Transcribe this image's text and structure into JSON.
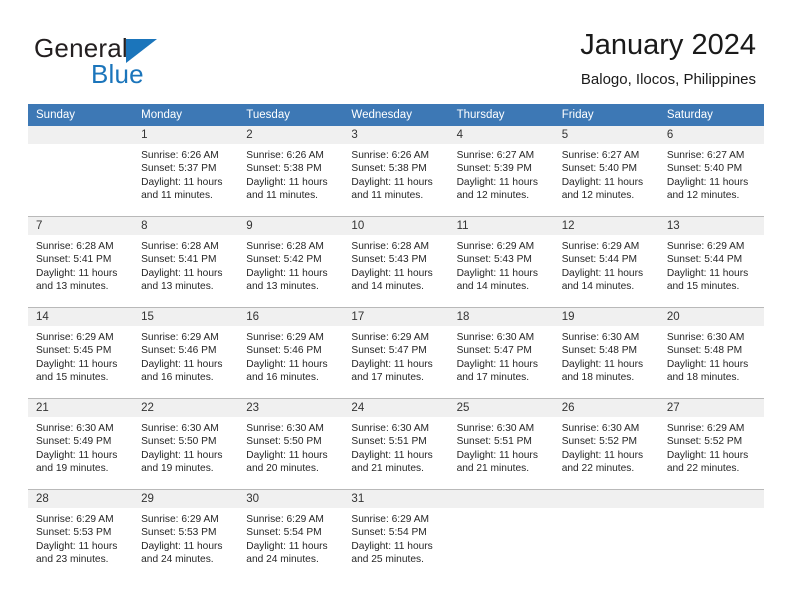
{
  "brand": {
    "name_part1": "General",
    "name_part2": "Blue",
    "accent_color": "#1b75bb"
  },
  "header": {
    "title": "January 2024",
    "subtitle": "Balogo, Ilocos, Philippines"
  },
  "calendar": {
    "header_color": "#3d78b5",
    "daynum_bg": "#f0f0f0",
    "weekdays": [
      "Sunday",
      "Monday",
      "Tuesday",
      "Wednesday",
      "Thursday",
      "Friday",
      "Saturday"
    ],
    "weeks": [
      [
        {
          "day": "",
          "lines": []
        },
        {
          "day": "1",
          "lines": [
            "Sunrise: 6:26 AM",
            "Sunset: 5:37 PM",
            "Daylight: 11 hours",
            "and 11 minutes."
          ]
        },
        {
          "day": "2",
          "lines": [
            "Sunrise: 6:26 AM",
            "Sunset: 5:38 PM",
            "Daylight: 11 hours",
            "and 11 minutes."
          ]
        },
        {
          "day": "3",
          "lines": [
            "Sunrise: 6:26 AM",
            "Sunset: 5:38 PM",
            "Daylight: 11 hours",
            "and 11 minutes."
          ]
        },
        {
          "day": "4",
          "lines": [
            "Sunrise: 6:27 AM",
            "Sunset: 5:39 PM",
            "Daylight: 11 hours",
            "and 12 minutes."
          ]
        },
        {
          "day": "5",
          "lines": [
            "Sunrise: 6:27 AM",
            "Sunset: 5:40 PM",
            "Daylight: 11 hours",
            "and 12 minutes."
          ]
        },
        {
          "day": "6",
          "lines": [
            "Sunrise: 6:27 AM",
            "Sunset: 5:40 PM",
            "Daylight: 11 hours",
            "and 12 minutes."
          ]
        }
      ],
      [
        {
          "day": "7",
          "lines": [
            "Sunrise: 6:28 AM",
            "Sunset: 5:41 PM",
            "Daylight: 11 hours",
            "and 13 minutes."
          ]
        },
        {
          "day": "8",
          "lines": [
            "Sunrise: 6:28 AM",
            "Sunset: 5:41 PM",
            "Daylight: 11 hours",
            "and 13 minutes."
          ]
        },
        {
          "day": "9",
          "lines": [
            "Sunrise: 6:28 AM",
            "Sunset: 5:42 PM",
            "Daylight: 11 hours",
            "and 13 minutes."
          ]
        },
        {
          "day": "10",
          "lines": [
            "Sunrise: 6:28 AM",
            "Sunset: 5:43 PM",
            "Daylight: 11 hours",
            "and 14 minutes."
          ]
        },
        {
          "day": "11",
          "lines": [
            "Sunrise: 6:29 AM",
            "Sunset: 5:43 PM",
            "Daylight: 11 hours",
            "and 14 minutes."
          ]
        },
        {
          "day": "12",
          "lines": [
            "Sunrise: 6:29 AM",
            "Sunset: 5:44 PM",
            "Daylight: 11 hours",
            "and 14 minutes."
          ]
        },
        {
          "day": "13",
          "lines": [
            "Sunrise: 6:29 AM",
            "Sunset: 5:44 PM",
            "Daylight: 11 hours",
            "and 15 minutes."
          ]
        }
      ],
      [
        {
          "day": "14",
          "lines": [
            "Sunrise: 6:29 AM",
            "Sunset: 5:45 PM",
            "Daylight: 11 hours",
            "and 15 minutes."
          ]
        },
        {
          "day": "15",
          "lines": [
            "Sunrise: 6:29 AM",
            "Sunset: 5:46 PM",
            "Daylight: 11 hours",
            "and 16 minutes."
          ]
        },
        {
          "day": "16",
          "lines": [
            "Sunrise: 6:29 AM",
            "Sunset: 5:46 PM",
            "Daylight: 11 hours",
            "and 16 minutes."
          ]
        },
        {
          "day": "17",
          "lines": [
            "Sunrise: 6:29 AM",
            "Sunset: 5:47 PM",
            "Daylight: 11 hours",
            "and 17 minutes."
          ]
        },
        {
          "day": "18",
          "lines": [
            "Sunrise: 6:30 AM",
            "Sunset: 5:47 PM",
            "Daylight: 11 hours",
            "and 17 minutes."
          ]
        },
        {
          "day": "19",
          "lines": [
            "Sunrise: 6:30 AM",
            "Sunset: 5:48 PM",
            "Daylight: 11 hours",
            "and 18 minutes."
          ]
        },
        {
          "day": "20",
          "lines": [
            "Sunrise: 6:30 AM",
            "Sunset: 5:48 PM",
            "Daylight: 11 hours",
            "and 18 minutes."
          ]
        }
      ],
      [
        {
          "day": "21",
          "lines": [
            "Sunrise: 6:30 AM",
            "Sunset: 5:49 PM",
            "Daylight: 11 hours",
            "and 19 minutes."
          ]
        },
        {
          "day": "22",
          "lines": [
            "Sunrise: 6:30 AM",
            "Sunset: 5:50 PM",
            "Daylight: 11 hours",
            "and 19 minutes."
          ]
        },
        {
          "day": "23",
          "lines": [
            "Sunrise: 6:30 AM",
            "Sunset: 5:50 PM",
            "Daylight: 11 hours",
            "and 20 minutes."
          ]
        },
        {
          "day": "24",
          "lines": [
            "Sunrise: 6:30 AM",
            "Sunset: 5:51 PM",
            "Daylight: 11 hours",
            "and 21 minutes."
          ]
        },
        {
          "day": "25",
          "lines": [
            "Sunrise: 6:30 AM",
            "Sunset: 5:51 PM",
            "Daylight: 11 hours",
            "and 21 minutes."
          ]
        },
        {
          "day": "26",
          "lines": [
            "Sunrise: 6:30 AM",
            "Sunset: 5:52 PM",
            "Daylight: 11 hours",
            "and 22 minutes."
          ]
        },
        {
          "day": "27",
          "lines": [
            "Sunrise: 6:29 AM",
            "Sunset: 5:52 PM",
            "Daylight: 11 hours",
            "and 22 minutes."
          ]
        }
      ],
      [
        {
          "day": "28",
          "lines": [
            "Sunrise: 6:29 AM",
            "Sunset: 5:53 PM",
            "Daylight: 11 hours",
            "and 23 minutes."
          ]
        },
        {
          "day": "29",
          "lines": [
            "Sunrise: 6:29 AM",
            "Sunset: 5:53 PM",
            "Daylight: 11 hours",
            "and 24 minutes."
          ]
        },
        {
          "day": "30",
          "lines": [
            "Sunrise: 6:29 AM",
            "Sunset: 5:54 PM",
            "Daylight: 11 hours",
            "and 24 minutes."
          ]
        },
        {
          "day": "31",
          "lines": [
            "Sunrise: 6:29 AM",
            "Sunset: 5:54 PM",
            "Daylight: 11 hours",
            "and 25 minutes."
          ]
        },
        {
          "day": "",
          "lines": []
        },
        {
          "day": "",
          "lines": []
        },
        {
          "day": "",
          "lines": []
        }
      ]
    ]
  }
}
